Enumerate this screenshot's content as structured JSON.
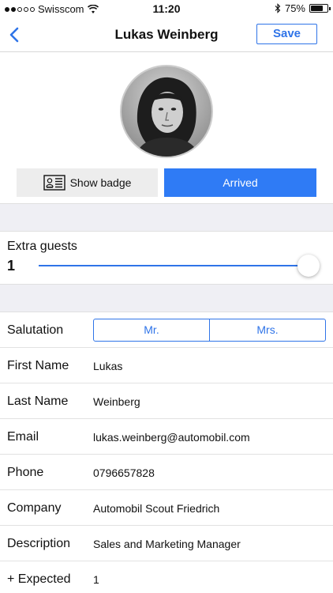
{
  "status_bar": {
    "carrier": "Swisscom",
    "time": "11:20",
    "battery": "75%",
    "battery_level": 0.75
  },
  "nav": {
    "title": "Lukas Weinberg",
    "save_label": "Save",
    "back_icon": "chevron-left-icon"
  },
  "profile": {
    "show_badge_label": "Show badge",
    "arrived_label": "Arrived"
  },
  "extra_guests": {
    "label": "Extra guests",
    "value": "1"
  },
  "form": {
    "salutation_label": "Salutation",
    "salutation_options": [
      "Mr.",
      "Mrs."
    ],
    "fields": [
      {
        "label": "First Name",
        "value": "Lukas"
      },
      {
        "label": "Last Name",
        "value": "Weinberg"
      },
      {
        "label": "Email",
        "value": "lukas.weinberg@automobil.com"
      },
      {
        "label": "Phone",
        "value": "0796657828"
      },
      {
        "label": "Company",
        "value": "Automobil Scout Friedrich"
      },
      {
        "label": "Description",
        "value": "Sales and Marketing Manager"
      },
      {
        "label": "+ Expected",
        "value": "1"
      }
    ]
  },
  "colors": {
    "accent": "#2f74e8",
    "arrived_button": "#2f7bf5",
    "section_gap": "#efeff4"
  }
}
